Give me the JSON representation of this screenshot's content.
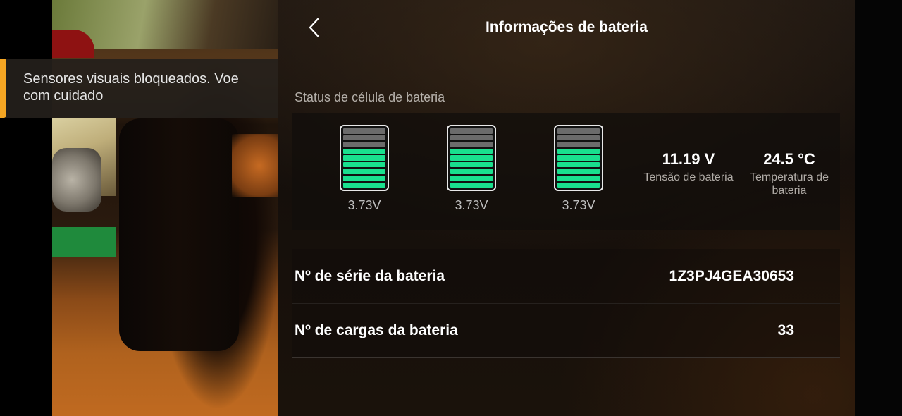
{
  "header": {
    "title": "Informações de bateria"
  },
  "toast": {
    "message": "Sensores visuais bloqueados. Voe com cuidado"
  },
  "cell_status": {
    "label": "Status de célula de bateria",
    "cells": [
      {
        "voltage": "3.73V",
        "charge_segments_filled": 6,
        "total_segments": 9
      },
      {
        "voltage": "3.73V",
        "charge_segments_filled": 6,
        "total_segments": 9
      },
      {
        "voltage": "3.73V",
        "charge_segments_filled": 6,
        "total_segments": 9
      }
    ],
    "voltage": {
      "value": "11.19 V",
      "label": "Tensão de bateria"
    },
    "temperature": {
      "value": "24.5 °C",
      "label": "Temperatura de bateria"
    }
  },
  "rows": [
    {
      "label": "Nº de série da bateria",
      "value": "1Z3PJ4GEA30653"
    },
    {
      "label": "Nº de cargas da bateria",
      "value": "33"
    }
  ],
  "colors": {
    "accent": "#f5a623",
    "cell_fill": "#19e08e",
    "cell_empty": "#6b6b6b"
  },
  "icons": {
    "back": "chevron-left-icon"
  }
}
